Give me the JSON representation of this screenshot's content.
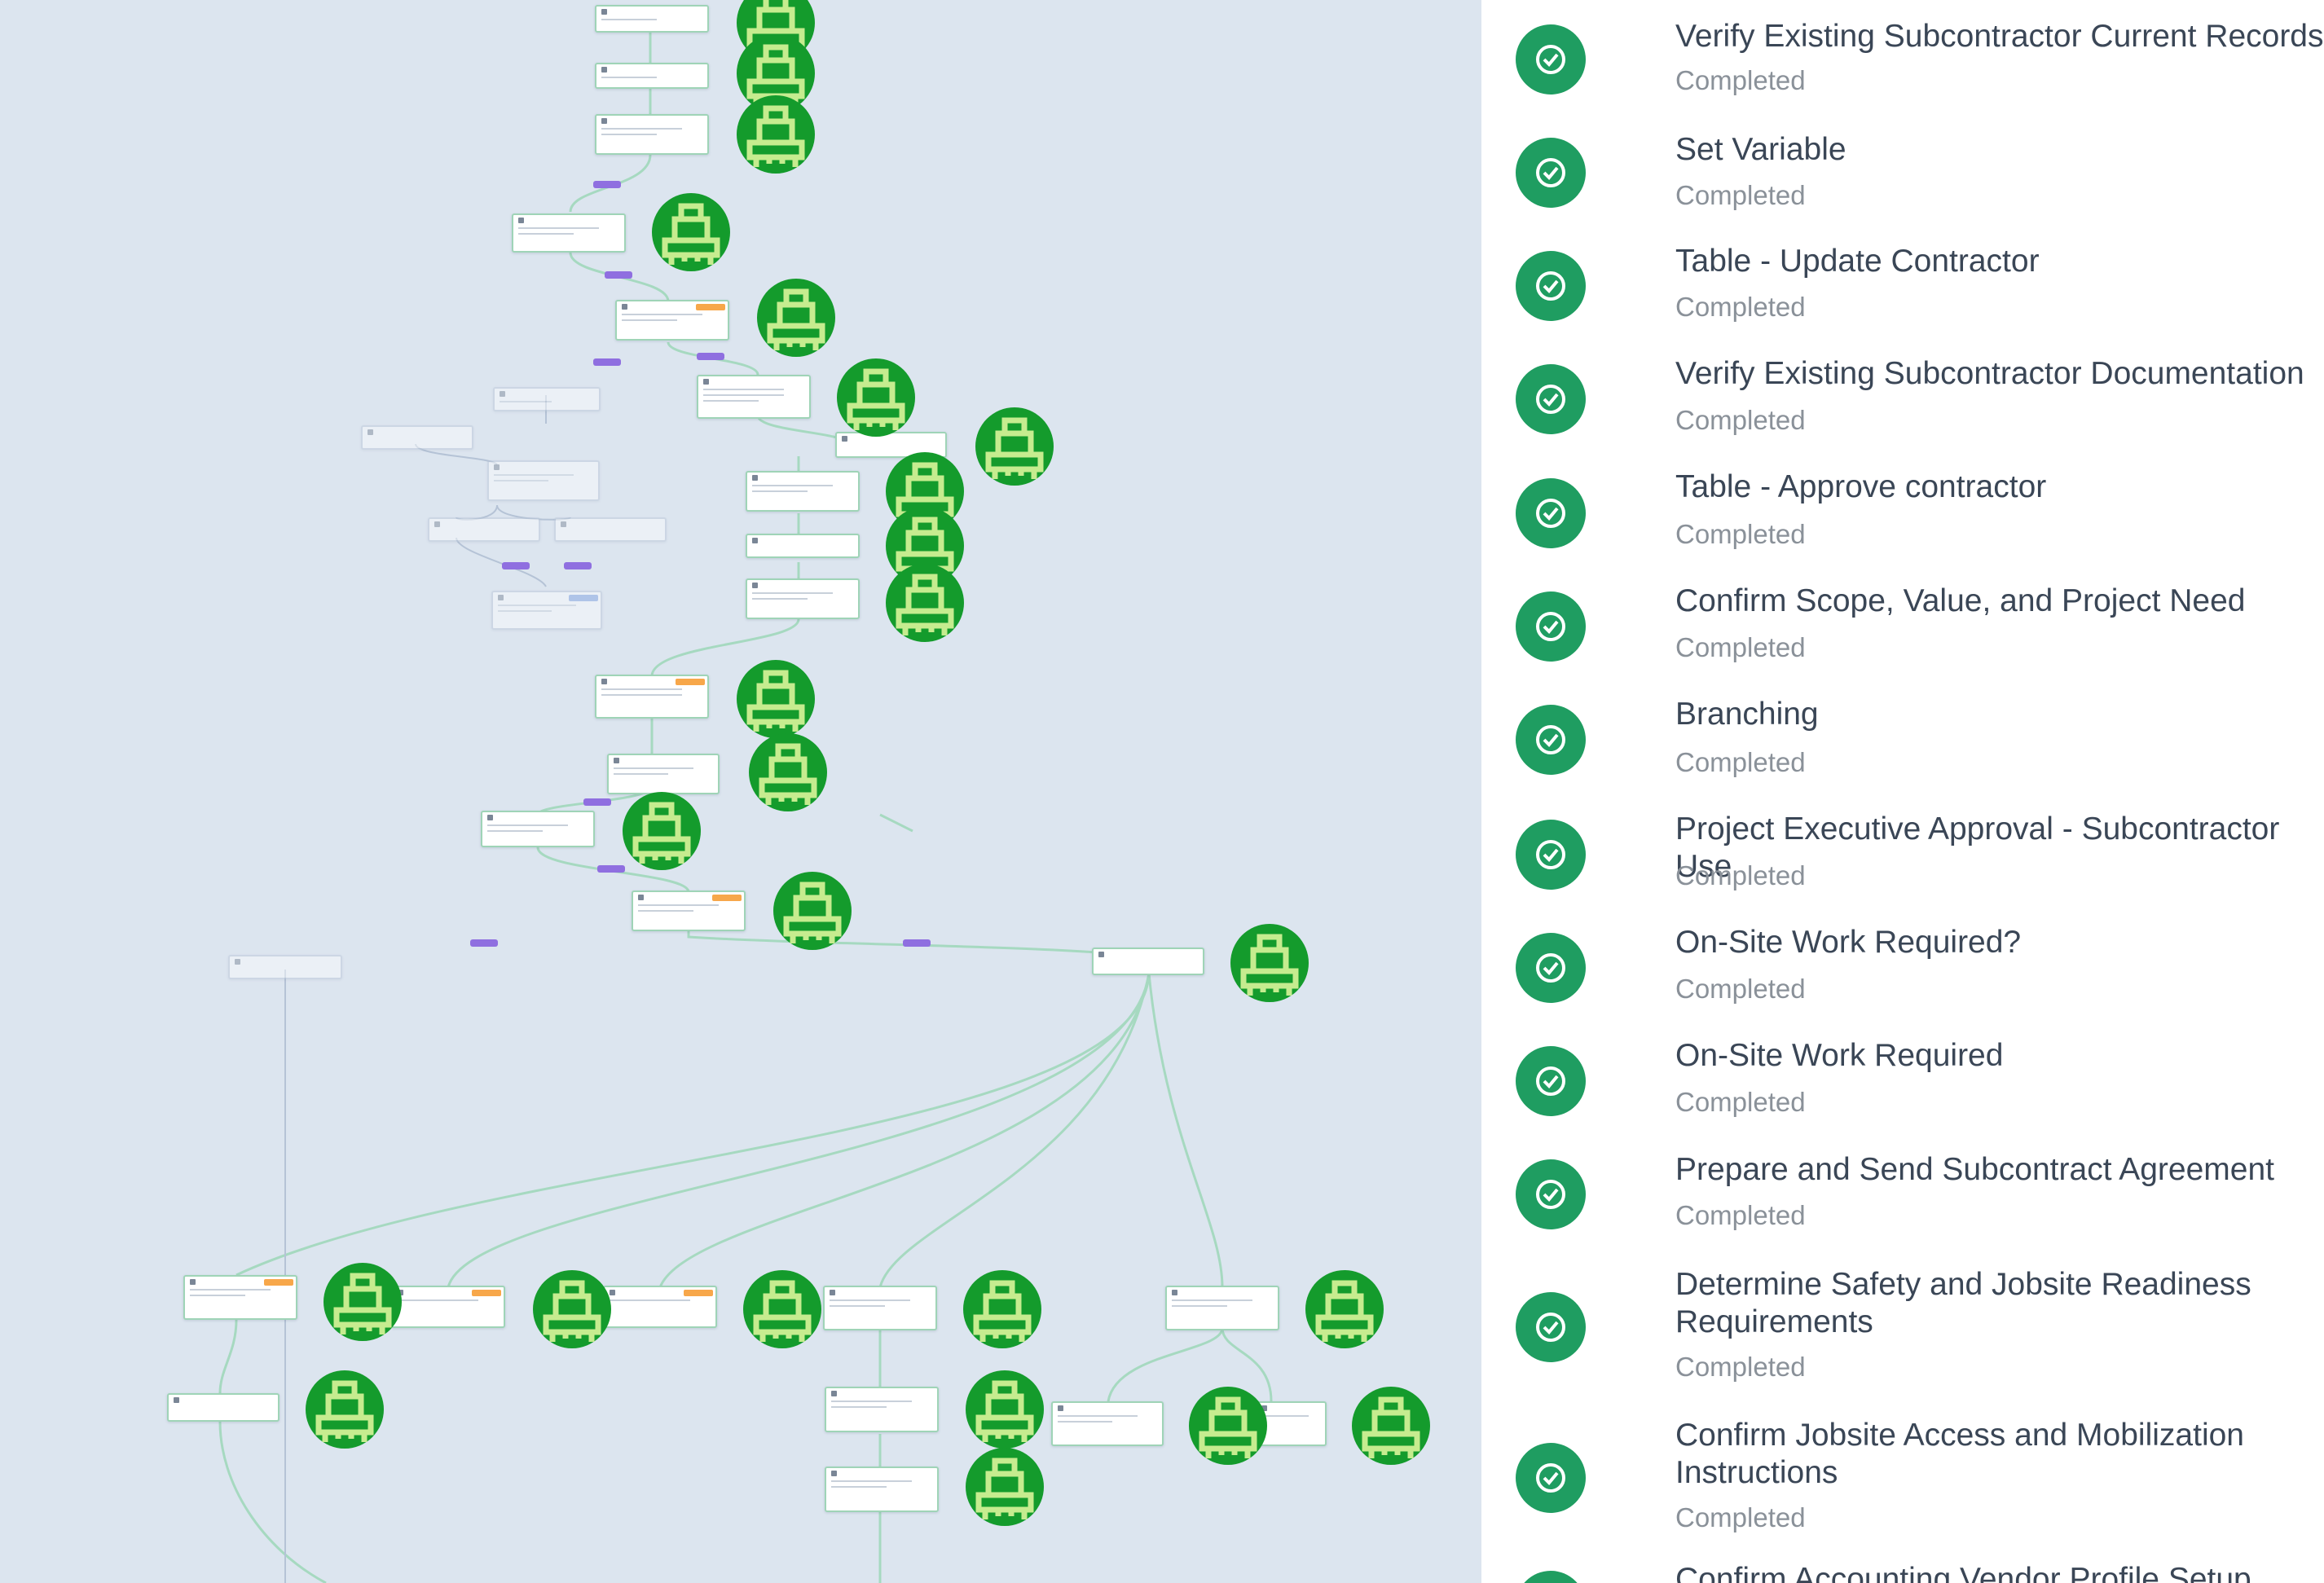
{
  "canvas": {
    "background": "#dce5ef",
    "node_accent": "#9fd4b7",
    "avatar_color": "#149b2c",
    "avatar_icon": "robot-avatar-icon",
    "connector_badge_color": "#8f6fe0",
    "warning_tag_color": "#f7a74a"
  },
  "steps": [
    {
      "title": "Verify Existing Subcontractor Current Records",
      "status": "Completed"
    },
    {
      "title": "Set Variable",
      "status": "Completed"
    },
    {
      "title": "Table - Update Contractor",
      "status": "Completed"
    },
    {
      "title": "Verify Existing Subcontractor Documentation",
      "status": "Completed"
    },
    {
      "title": "Table - Approve contractor",
      "status": "Completed"
    },
    {
      "title": "Confirm Scope, Value, and Project Need",
      "status": "Completed"
    },
    {
      "title": "Branching",
      "status": "Completed"
    },
    {
      "title": "Project Executive Approval - Subcontractor Use",
      "status": "Completed"
    },
    {
      "title": "On-Site Work Required?",
      "status": "Completed"
    },
    {
      "title": "On-Site Work Required",
      "status": "Completed"
    },
    {
      "title": "Prepare and Send Subcontract Agreement",
      "status": "Completed"
    },
    {
      "title": "Determine Safety and Jobsite Readiness Requirements",
      "status": "Completed"
    },
    {
      "title": "Confirm Jobsite Access and Mobilization Instructions",
      "status": "Completed"
    },
    {
      "title": "Confirm Accounting Vendor Profile Setup",
      "status": ""
    }
  ],
  "status_icon": "check-circle-icon",
  "status_color": "#1f9d61"
}
